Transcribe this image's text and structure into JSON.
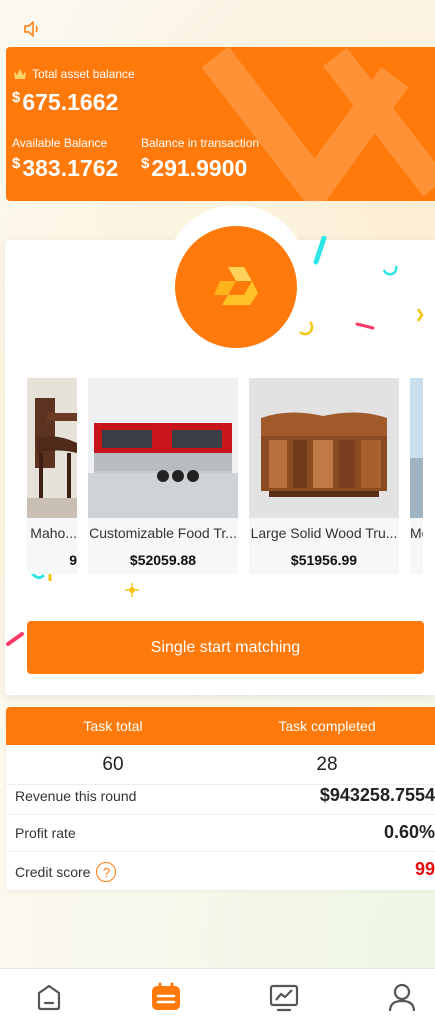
{
  "header": {
    "total_label": "Total asset balance",
    "currency_symbol": "$",
    "total_value": "675.1662",
    "available_label": "Available Balance",
    "available_value": "383.1762",
    "transaction_label": "Balance in transaction",
    "transaction_value": "291.9900"
  },
  "products": [
    {
      "name": "Maho...",
      "price": "9",
      "image": "dining-chair"
    },
    {
      "name": "Customizable Food Tr...",
      "price": "$52059.88",
      "image": "food-trailer"
    },
    {
      "name": "Large Solid Wood Tru...",
      "price": "$51956.99",
      "image": "wood-trunk"
    },
    {
      "name": "Mo",
      "price": "",
      "image": "landscape"
    }
  ],
  "start_button": "Single start matching",
  "tasks": {
    "total_label": "Task total",
    "completed_label": "Task completed",
    "total_value": "60",
    "completed_value": "28",
    "revenue_label": "Revenue this round",
    "revenue_value": "$943258.7554",
    "profit_label": "Profit rate",
    "profit_value": "0.60%",
    "credit_label": "Credit score",
    "credit_value": "99"
  },
  "nav": [
    {
      "icon": "home-icon"
    },
    {
      "icon": "orders-icon",
      "active": true
    },
    {
      "icon": "chart-icon"
    },
    {
      "icon": "profile-icon"
    }
  ],
  "colors": {
    "accent": "#ff7a0a",
    "credit": "#e40d0d"
  }
}
